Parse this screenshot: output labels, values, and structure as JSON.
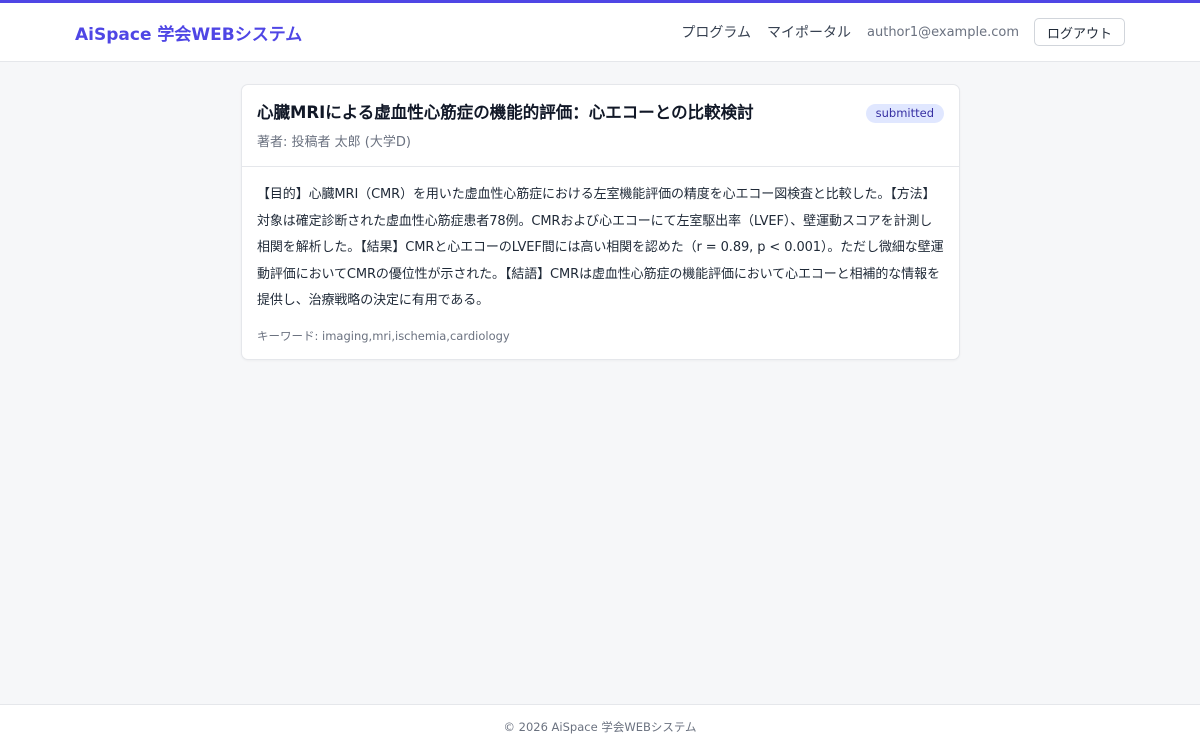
{
  "header": {
    "brand": "AiSpace 学会WEBシステム",
    "nav": {
      "program": "プログラム",
      "my_portal": "マイポータル",
      "user_email": "author1@example.com",
      "logout": "ログアウト"
    },
    "accent_color": "#4f46e5"
  },
  "paper": {
    "title": "心臓MRIによる虚血性心筋症の機能的評価：心エコーとの比較検討",
    "status": "submitted",
    "authors": "著者: 投稿者 太郎 (大学D)",
    "abstract": "【目的】心臓MRI（CMR）を用いた虚血性心筋症における左室機能評価の精度を心エコー図検査と比較した。【方法】対象は確定診断された虚血性心筋症患者78例。CMRおよび心エコーにて左室駆出率（LVEF）、壁運動スコアを計測し相関を解析した。【結果】CMRと心エコーのLVEF間には高い相関を認めた（r = 0.89, p < 0.001）。ただし微細な壁運動評価においてCMRの優位性が示された。【結語】CMRは虚血性心筋症の機能評価において心エコーと相補的な情報を提供し、治療戦略の決定に有用である。",
    "keywords": "キーワード: imaging,mri,ischemia,cardiology"
  },
  "footer": {
    "copyright": "© 2026 AiSpace 学会WEBシステム"
  }
}
